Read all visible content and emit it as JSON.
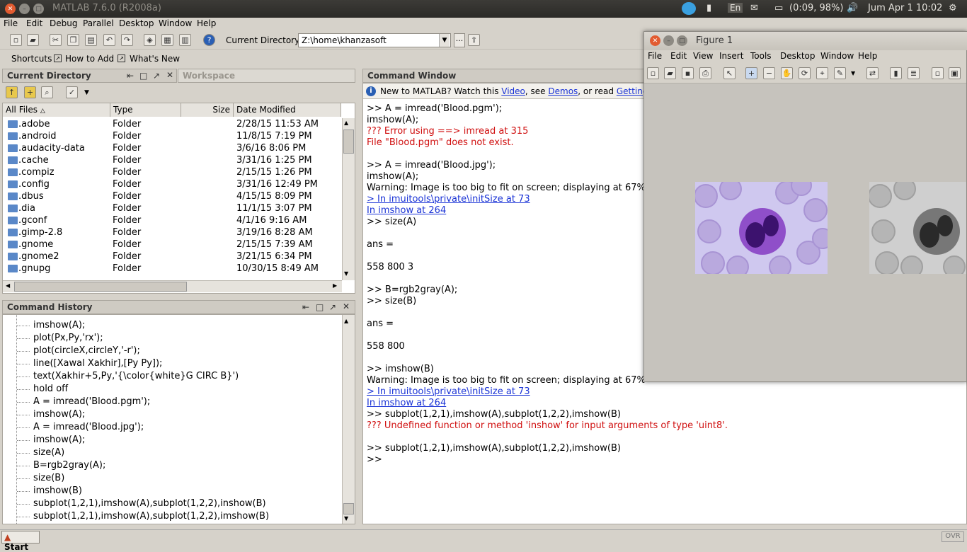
{
  "window": {
    "title": "MATLAB 7.6.0 (R2008a)"
  },
  "tray": {
    "battery": "(0:09, 98%)",
    "clock": "Jum Apr  1 10:02",
    "lang": "En"
  },
  "menubar": [
    "File",
    "Edit",
    "Debug",
    "Parallel",
    "Desktop",
    "Window",
    "Help"
  ],
  "toolbar": {
    "current_dir_label": "Current Directory:",
    "current_dir_value": "Z:\\home\\khanzasoft",
    "browse": "..."
  },
  "shortcuts": {
    "label": "Shortcuts",
    "howto": "How to Add",
    "whatsnew": "What's New"
  },
  "current_directory": {
    "title": "Current Directory",
    "workspace_tab": "Workspace",
    "columns": [
      "All Files",
      "Type",
      "Size",
      "Date Modified"
    ],
    "rows": [
      {
        "name": ".adobe",
        "type": "Folder",
        "date": "2/28/15 11:53 AM"
      },
      {
        "name": ".android",
        "type": "Folder",
        "date": "11/8/15 7:19 PM"
      },
      {
        "name": ".audacity-data",
        "type": "Folder",
        "date": "3/6/16 8:06 PM"
      },
      {
        "name": ".cache",
        "type": "Folder",
        "date": "3/31/16 1:25 PM"
      },
      {
        "name": ".compiz",
        "type": "Folder",
        "date": "2/15/15 1:26 PM"
      },
      {
        "name": ".config",
        "type": "Folder",
        "date": "3/31/16 12:49 PM"
      },
      {
        "name": ".dbus",
        "type": "Folder",
        "date": "4/15/15 8:09 PM"
      },
      {
        "name": ".dia",
        "type": "Folder",
        "date": "11/1/15 3:07 PM"
      },
      {
        "name": ".gconf",
        "type": "Folder",
        "date": "4/1/16 9:16 AM"
      },
      {
        "name": ".gimp-2.8",
        "type": "Folder",
        "date": "3/19/16 8:28 AM"
      },
      {
        "name": ".gnome",
        "type": "Folder",
        "date": "2/15/15 7:39 AM"
      },
      {
        "name": ".gnome2",
        "type": "Folder",
        "date": "3/21/15 6:34 PM"
      },
      {
        "name": ".gnupg",
        "type": "Folder",
        "date": "10/30/15 8:49 AM"
      }
    ]
  },
  "history": {
    "title": "Command History",
    "lines": [
      "imshow(A);",
      "plot(Px,Py,'rx');",
      "plot(circleX,circleY,'-r');",
      "line([Xawal Xakhir],[Py Py]);",
      "text(Xakhir+5,Py,'{\\color{white}G CIRC B}')",
      "hold off",
      "A = imread('Blood.pgm');",
      "imshow(A);",
      "A = imread('Blood.jpg');",
      "imshow(A);",
      "size(A)",
      "B=rgb2gray(A);",
      "size(B)",
      "imshow(B)",
      "subplot(1,2,1),imshow(A),subplot(1,2,2),inshow(B)",
      "subplot(1,2,1),imshow(A),subplot(1,2,2),imshow(B)"
    ]
  },
  "command_window": {
    "title": "Command Window",
    "info_prefix": "New to MATLAB? Watch this ",
    "info_video": "Video",
    "info_mid": ", see ",
    "info_demos": "Demos",
    "info_mid2": ", or read ",
    "info_gs": "Getting Started",
    "info_end": ".",
    "lines": [
      ">> A = imread('Blood.pgm');",
      "imshow(A);",
      "??? Error using ==> imread at 315",
      "File \"Blood.pgm\" does not exist.",
      "",
      ">> A = imread('Blood.jpg');",
      "imshow(A);",
      "Warning: Image is too big to fit on screen; displaying at 67%",
      "> In imuitools\\private\\initSize at 73",
      "  In imshow at 264",
      ">> size(A)",
      "",
      "ans =",
      "",
      "   558   800     3",
      "",
      ">> B=rgb2gray(A);",
      ">> size(B)",
      "",
      "ans =",
      "",
      "   558   800",
      "",
      ">> imshow(B)",
      "Warning: Image is too big to fit on screen; displaying at 67%",
      "> In imuitools\\private\\initSize at 73",
      "  In imshow at 264",
      ">> subplot(1,2,1),imshow(A),subplot(1,2,2),imshow(B)",
      "??? Undefined function or method 'inshow' for input arguments of type 'uint8'.",
      "",
      ">> subplot(1,2,1),imshow(A),subplot(1,2,2),imshow(B)",
      ">>"
    ]
  },
  "figure": {
    "title": "Figure 1",
    "menu": [
      "File",
      "Edit",
      "View",
      "Insert",
      "Tools",
      "Desktop",
      "Window",
      "Help"
    ]
  },
  "status": {
    "start": "Start",
    "ovr": "OVR"
  }
}
